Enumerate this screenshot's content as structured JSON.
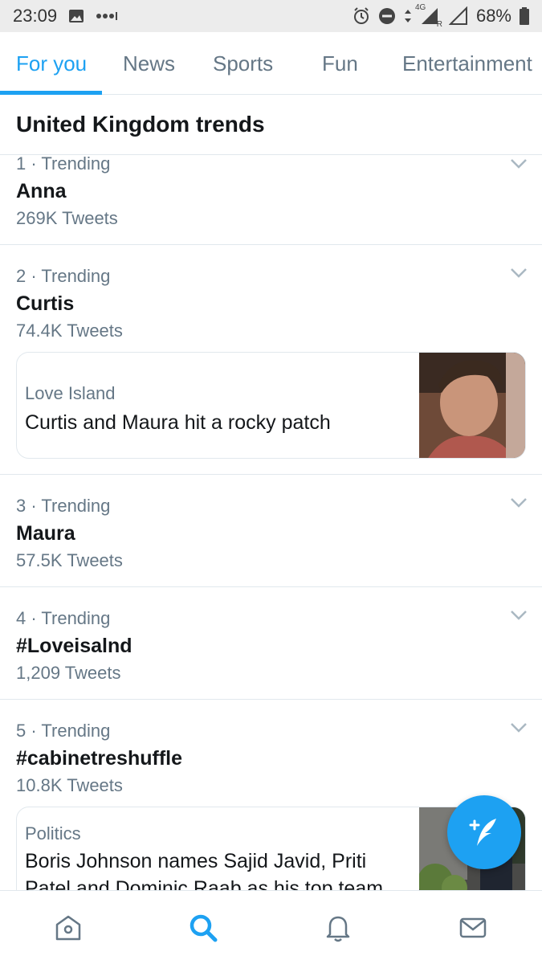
{
  "status_bar": {
    "time": "23:09",
    "network": "4G",
    "roaming": "R",
    "battery": "68%"
  },
  "tabs": [
    {
      "label": "For you",
      "active": true
    },
    {
      "label": "News",
      "active": false
    },
    {
      "label": "Sports",
      "active": false
    },
    {
      "label": "Fun",
      "active": false
    },
    {
      "label": "Entertainment",
      "active": false
    }
  ],
  "section_title": "United Kingdom trends",
  "trends": [
    {
      "meta": "1 · Trending",
      "name": "Anna",
      "count": "269K Tweets"
    },
    {
      "meta": "2 · Trending",
      "name": "Curtis",
      "count": "74.4K Tweets",
      "card": {
        "category": "Love Island",
        "headline": "Curtis and Maura hit a rocky patch"
      }
    },
    {
      "meta": "3 · Trending",
      "name": "Maura",
      "count": "57.5K Tweets"
    },
    {
      "meta": "4 · Trending",
      "name": "#Loveisalnd",
      "count": "1,209 Tweets"
    },
    {
      "meta": "5 · Trending",
      "name": "#cabinetreshuffle",
      "count": "10.8K Tweets",
      "card": {
        "category": "Politics",
        "headline": "Boris Johnson names Sajid Javid, Priti Patel and Dominic Raab as his top team"
      }
    }
  ],
  "colors": {
    "accent": "#1da1f2",
    "text_secondary": "#657786",
    "divider": "#e1e8ed"
  },
  "bottom_nav": [
    {
      "icon": "home-icon",
      "active": false
    },
    {
      "icon": "search-icon",
      "active": true
    },
    {
      "icon": "notifications-bell-icon",
      "active": false
    },
    {
      "icon": "messages-envelope-icon",
      "active": false
    }
  ],
  "fab_icon": "compose-tweet-icon"
}
